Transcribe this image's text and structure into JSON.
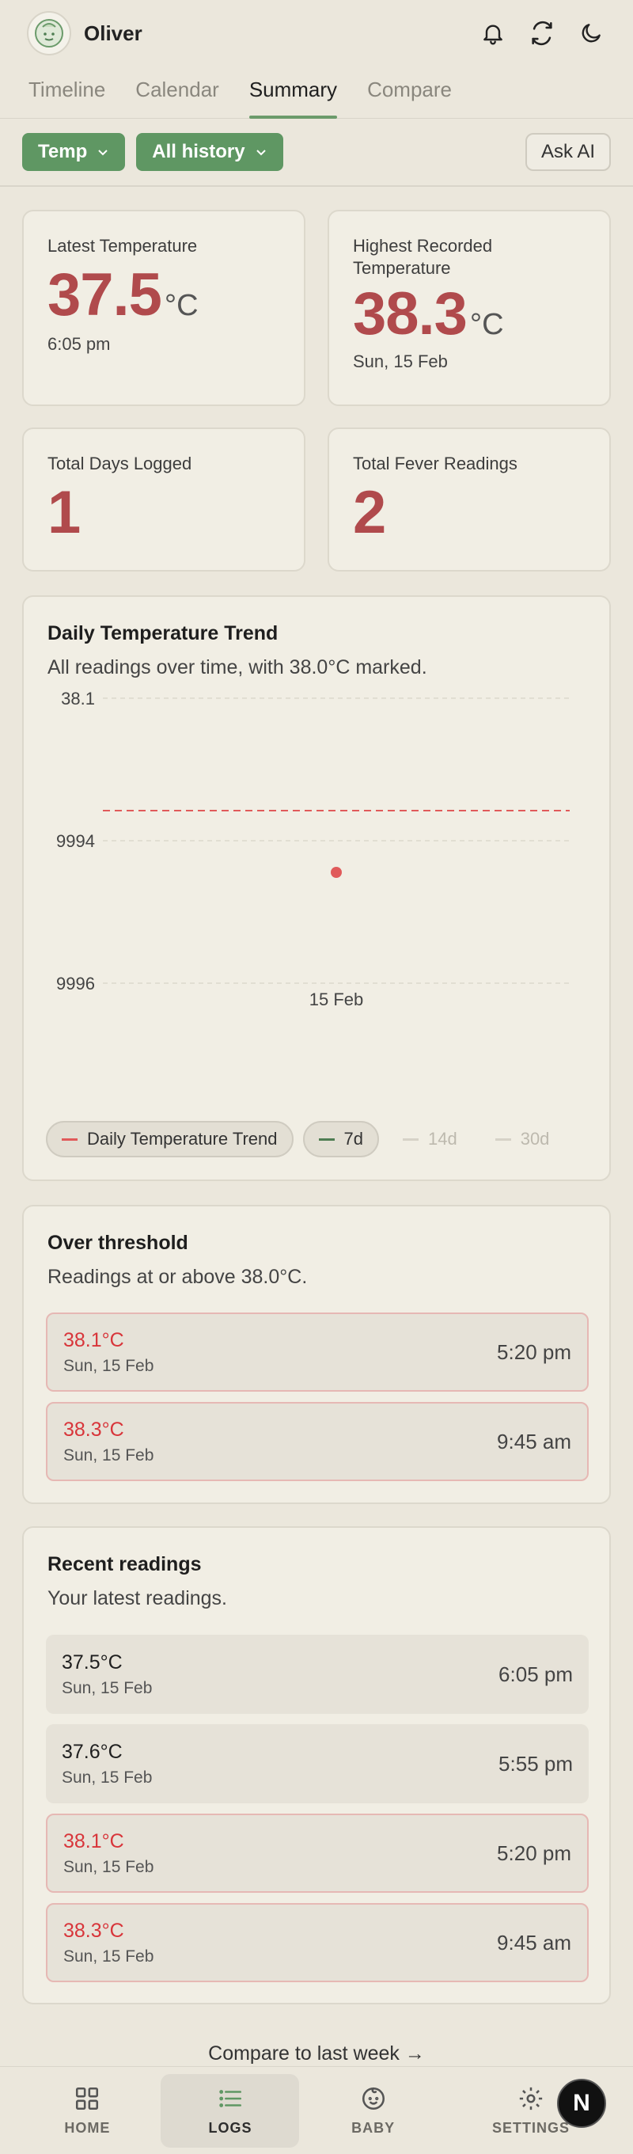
{
  "header": {
    "baby_name": "Oliver",
    "icons": [
      "bell-icon",
      "refresh-icon",
      "moon-icon"
    ]
  },
  "tabs": [
    {
      "label": "Timeline",
      "active": false
    },
    {
      "label": "Calendar",
      "active": false
    },
    {
      "label": "Summary",
      "active": true
    },
    {
      "label": "Compare",
      "active": false
    }
  ],
  "filters": {
    "metric": "Temp",
    "range": "All history",
    "ask_ai": "Ask AI"
  },
  "stats": {
    "latest": {
      "label": "Latest Temperature",
      "value": "37.5",
      "unit": "°C",
      "sub": "6:05 pm"
    },
    "highest": {
      "label": "Highest Recorded Temperature",
      "value": "38.3",
      "unit": "°C",
      "sub": "Sun, 15 Feb"
    },
    "days": {
      "label": "Total Days Logged",
      "value": "1"
    },
    "fever": {
      "label": "Total Fever Readings",
      "value": "2"
    }
  },
  "trend": {
    "title": "Daily Temperature Trend",
    "subtitle": "All readings over time, with 38.0°C marked.",
    "legend": [
      {
        "label": "Daily Temperature Trend",
        "color": "#e05a5a",
        "on": true
      },
      {
        "label": "7d",
        "color": "#4e7d52",
        "on": true
      },
      {
        "label": "14d",
        "color": "#cfcbc0",
        "on": false
      },
      {
        "label": "30d",
        "color": "#cfcbc0",
        "on": false
      }
    ]
  },
  "chart_data": {
    "type": "line",
    "x": [
      "15 Feb"
    ],
    "series": [
      {
        "name": "Daily Temperature Trend",
        "values": [
          37.95
        ]
      }
    ],
    "threshold": 38.0,
    "y_tick_labels": [
      "38.1",
      "9994",
      "9996"
    ],
    "ylim": [
      37.9,
      38.1
    ],
    "threshold_color": "#e05a5a",
    "point_color": "#e05a5a",
    "grid": true
  },
  "threshold": {
    "title": "Over threshold",
    "subtitle": "Readings at or above 38.0°C.",
    "rows": [
      {
        "temp": "38.1°C",
        "date": "Sun, 15 Feb",
        "time": "5:20 pm"
      },
      {
        "temp": "38.3°C",
        "date": "Sun, 15 Feb",
        "time": "9:45 am"
      }
    ]
  },
  "recent": {
    "title": "Recent readings",
    "subtitle": "Your latest readings.",
    "rows": [
      {
        "temp": "37.5°C",
        "date": "Sun, 15 Feb",
        "time": "6:05 pm",
        "alert": false
      },
      {
        "temp": "37.6°C",
        "date": "Sun, 15 Feb",
        "time": "5:55 pm",
        "alert": false
      },
      {
        "temp": "38.1°C",
        "date": "Sun, 15 Feb",
        "time": "5:20 pm",
        "alert": true
      },
      {
        "temp": "38.3°C",
        "date": "Sun, 15 Feb",
        "time": "9:45 am",
        "alert": true
      }
    ]
  },
  "compare_link": "Compare to last week →",
  "nav": [
    {
      "label": "HOME",
      "icon": "grid-icon",
      "active": false
    },
    {
      "label": "LOGS",
      "icon": "list-icon",
      "active": true
    },
    {
      "label": "BABY",
      "icon": "baby-face-icon",
      "active": false
    },
    {
      "label": "SETTINGS",
      "icon": "gear-icon",
      "active": false
    }
  ],
  "fab": "N",
  "colors": {
    "accent": "#5f9763",
    "alert": "#d8353a",
    "stat_value": "#b04a4c",
    "background": "#ebe7dc"
  }
}
